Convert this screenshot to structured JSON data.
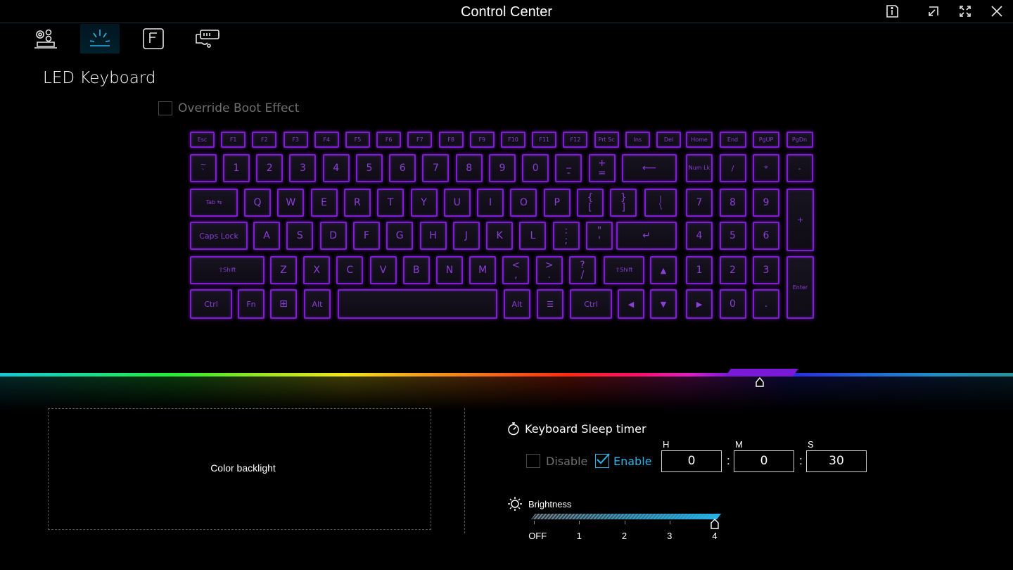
{
  "window": {
    "title": "Control Center",
    "buttons": [
      "info-icon",
      "restore-icon",
      "maximize-icon",
      "close-icon"
    ]
  },
  "tabs": [
    {
      "name": "system-settings-tab",
      "icon": "gears-laptop-icon",
      "active": false
    },
    {
      "name": "led-keyboard-tab",
      "icon": "led-light-icon",
      "active": true
    },
    {
      "name": "fn-keys-tab",
      "icon": "f-key-icon",
      "active": false
    },
    {
      "name": "power-tab",
      "icon": "battery-plug-icon",
      "active": false
    }
  ],
  "page": {
    "title": "LED Keyboard",
    "override_boot_effect": {
      "label": "Override Boot Effect",
      "checked": false
    }
  },
  "keyboard": {
    "glow_color": "#7d1fd0",
    "keys": [
      "Esc",
      "F1",
      "F2",
      "F3",
      "F4",
      "F5",
      "F6",
      "F7",
      "F8",
      "F9",
      "F10",
      "F11",
      "F12",
      "Prt Sc",
      "Ins",
      "Del",
      "Home",
      "End",
      "PgUP",
      "PgDn",
      "~\n`",
      "1",
      "2",
      "3",
      "4",
      "5",
      "6",
      "7",
      "8",
      "9",
      "0",
      "_\n-",
      "+\n=",
      "⟵",
      "Num Lk",
      "/",
      "*",
      "-",
      "Tab ⇆",
      "Q",
      "W",
      "E",
      "R",
      "T",
      "Y",
      "U",
      "I",
      "O",
      "P",
      "{\n[",
      "}\n]",
      "|\n\\",
      "7",
      "8",
      "9",
      "+",
      "Caps Lock",
      "A",
      "S",
      "D",
      "F",
      "G",
      "H",
      "J",
      "K",
      "L",
      ":\n;",
      "\"\n'",
      "↵",
      "4",
      "5",
      "6",
      "⇧Shift",
      "Z",
      "X",
      "C",
      "V",
      "B",
      "N",
      "M",
      "<\n,",
      ">\n.",
      "?\n/",
      "⇧Shift",
      "▲",
      "1",
      "2",
      "3",
      "Enter",
      "Ctrl",
      "Fn",
      "⊞",
      "Alt",
      "",
      "Alt",
      "☰",
      "Ctrl",
      "◀",
      "▼",
      "▶",
      "0",
      "."
    ]
  },
  "color_bar": {
    "selected_color": "#7a19d8"
  },
  "color_backlight": {
    "label": "Color backlight"
  },
  "sleep_timer": {
    "title": "Keyboard Sleep timer",
    "disable_label": "Disable",
    "enable_label": "Enable",
    "disable_checked": false,
    "enable_checked": true,
    "h_label": "H",
    "m_label": "M",
    "s_label": "S",
    "hours": "0",
    "minutes": "0",
    "seconds": "30",
    "separator": ":"
  },
  "brightness": {
    "title": "Brightness",
    "levels": [
      "OFF",
      "1",
      "2",
      "3",
      "4"
    ],
    "value": 4,
    "accent": "#27b4e8"
  }
}
